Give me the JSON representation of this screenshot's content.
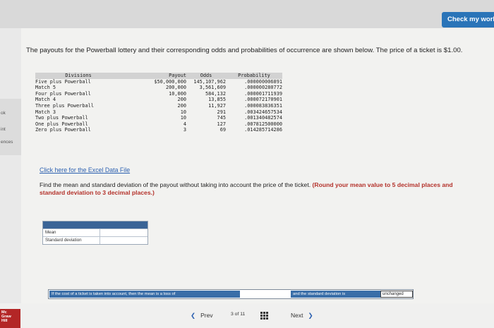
{
  "header": {
    "check_button": "Check my work"
  },
  "sidebar": {
    "items": [
      "ok",
      "int",
      "ences"
    ]
  },
  "problem": {
    "intro": "The payouts for the Powerball lottery and their corresponding odds and probabilities of occurrence are shown below. The price of a ticket is $1.00.",
    "table": {
      "headers": [
        "Divisions",
        "Payout",
        "Odds",
        "Probability"
      ],
      "rows": [
        [
          "Five plus Powerball",
          "$50,000,000",
          "145,107,962",
          ".000000006891"
        ],
        [
          "Match 5",
          "200,000",
          "3,561,609",
          ".000000280772"
        ],
        [
          "Four plus Powerball",
          "10,000",
          "584,132",
          ".000001711939"
        ],
        [
          "Match 4",
          "200",
          "13,855",
          ".000072170901"
        ],
        [
          "Three plus Powerball",
          "200",
          "11,927",
          ".000083836351"
        ],
        [
          "Match 3",
          "10",
          "291",
          ".003424657534"
        ],
        [
          "Two plus Powerball",
          "10",
          "745",
          ".001340482574"
        ],
        [
          "One plus Powerball",
          "4",
          "127",
          ".007812500000"
        ],
        [
          "Zero plus Powerball",
          "3",
          "69",
          ".014285714286"
        ]
      ]
    },
    "excel_link": "Click here for the Excel Data File",
    "question_text": "Find the mean and standard deviation of the payout without taking into account the price of the ticket.",
    "question_bold": "(Round your mean value to 5 decimal places and standard deviation to 3 decimal places.)"
  },
  "answer": {
    "mean_label": "Mean",
    "mean_value": "",
    "sd_label": "Standard deviation",
    "sd_value": ""
  },
  "sentence": {
    "part1": "If the cost of a ticket is taken into account, then the mean is a loss of",
    "part2": "and the standard deviation is",
    "dropdown": "unchanged"
  },
  "nav": {
    "prev": "Prev",
    "page_current": "3",
    "page_of": "of",
    "page_total": "11",
    "next": "Next"
  },
  "logo": {
    "lines": [
      "Mc",
      "Graw",
      "Hill"
    ]
  }
}
